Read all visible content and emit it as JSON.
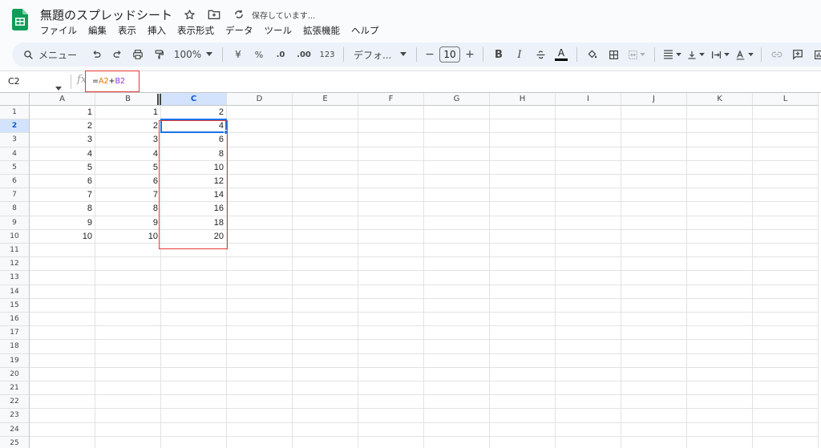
{
  "app": {
    "doc_title": "無題のスプレッドシート",
    "save_status": "保存しています...",
    "menu": [
      "ファイル",
      "編集",
      "表示",
      "挿入",
      "表示形式",
      "データ",
      "ツール",
      "拡張機能",
      "ヘルプ"
    ]
  },
  "toolbar": {
    "search_label": "メニュー",
    "zoom": "100%",
    "currency": "¥",
    "percent": "%",
    "decrease_decimal": ".0",
    "increase_decimal": ".00",
    "number_format": "123",
    "font_name": "デフォ...",
    "font_size": "10",
    "minus": "−",
    "plus": "+",
    "bold": "B",
    "italic": "I",
    "text_color": "A"
  },
  "formula_bar": {
    "name_box": "C2",
    "fx": "fx",
    "formula_parts": [
      "=",
      "A2",
      "+",
      "B2"
    ]
  },
  "grid": {
    "columns": [
      "A",
      "B",
      "C",
      "D",
      "E",
      "F",
      "G",
      "H",
      "I",
      "J",
      "K",
      "L"
    ],
    "rows": [
      "1",
      "2",
      "3",
      "4",
      "5",
      "6",
      "7",
      "8",
      "9",
      "10",
      "11",
      "12",
      "13",
      "14",
      "15",
      "16",
      "17",
      "18",
      "19",
      "20",
      "21",
      "22",
      "23",
      "24",
      "25"
    ],
    "selected_column": "C",
    "selected_row": "2",
    "data": {
      "A": [
        "1",
        "2",
        "3",
        "4",
        "5",
        "6",
        "7",
        "8",
        "9",
        "10"
      ],
      "B": [
        "1",
        "2",
        "3",
        "4",
        "5",
        "6",
        "7",
        "8",
        "9",
        "10"
      ],
      "C": [
        "2",
        "4",
        "6",
        "8",
        "10",
        "12",
        "14",
        "16",
        "18",
        "20"
      ]
    }
  },
  "colors": {
    "accent": "#1a73e8",
    "annotation": "#e53935",
    "ref_a2": "#e37400",
    "ref_b2": "#9334e6"
  }
}
